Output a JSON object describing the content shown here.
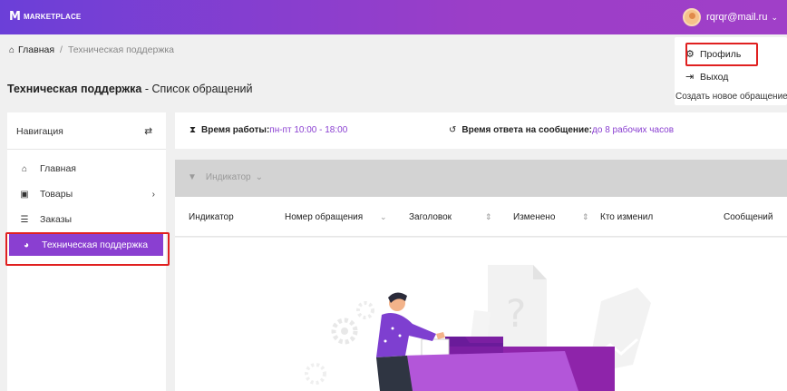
{
  "topbar": {
    "logo_mark": "M",
    "logo_text": "MARKETPLACE",
    "user_email": "rqrqr@mail.ru",
    "user_chevron": "⌄"
  },
  "breadcrumb": {
    "home": "Главная",
    "separator": "/",
    "current": "Техническая поддержка"
  },
  "page": {
    "title_bold": "Техническая поддержка",
    "title_rest": " - Список обращений",
    "create_button": "Создать новое обращение"
  },
  "user_menu": {
    "items": [
      {
        "label": "Профиль",
        "icon": "gear-icon"
      },
      {
        "label": "Выход",
        "icon": "logout-icon"
      }
    ]
  },
  "sidebar": {
    "heading": "Навигация",
    "toggle_icon": "swap-arrows-icon",
    "items": [
      {
        "label": "Главная",
        "icon": "home-icon"
      },
      {
        "label": "Товары",
        "icon": "box-icon",
        "arrow": "›"
      },
      {
        "label": "Заказы",
        "icon": "cart-icon"
      },
      {
        "label": "Техническая поддержка",
        "icon": "chat-icon",
        "active": true
      }
    ]
  },
  "info": {
    "work_label": "Время работы:",
    "work_value": " пн-пт 10:00 - 18:00",
    "reply_label": "Время ответа на сообщение:",
    "reply_value": " до 8 рабочих часов"
  },
  "filter": {
    "label": "Индикатор",
    "chevron": "⌄"
  },
  "table": {
    "columns": [
      "Индикатор",
      "Номер обращения",
      "Заголовок",
      "Изменено",
      "Кто изменил",
      "Сообщений"
    ]
  },
  "colors": {
    "accent": "#8a3fd1",
    "highlight": "#e02020"
  }
}
